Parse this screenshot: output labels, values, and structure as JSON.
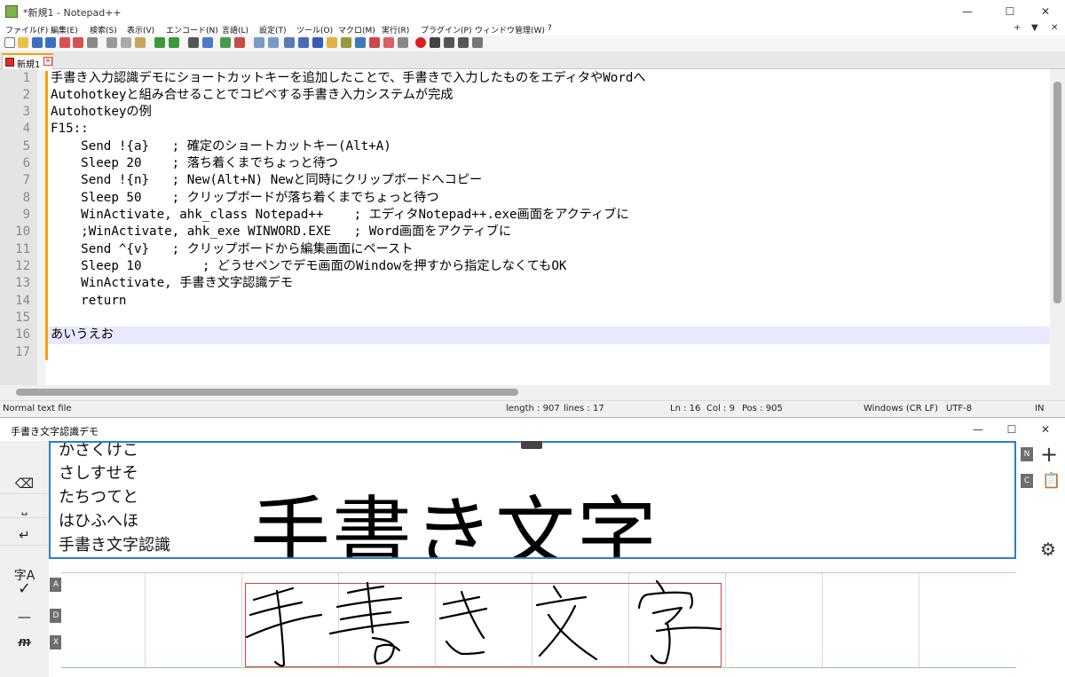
{
  "npp": {
    "title": "*新規1 - Notepad++",
    "menu": [
      "ファイル(F)",
      "編集(E)",
      "検索(S)",
      "表示(V)",
      "エンコード(N)",
      "言語(L)",
      "設定(T)",
      "ツール(O)",
      "マクロ(M)",
      "実行(R)",
      "プラグイン(P)",
      "ウィンドウ管理(W)",
      "?"
    ],
    "menu_right": [
      "+",
      "▼",
      "✕"
    ],
    "tab_label": "新規1",
    "lines": [
      "手書き入力認識デモにショートカットキーを追加したことで、手書きで入力したものをエディタやWordへ",
      "Autohotkeyと組み合せることでコピペする手書き入力システムが完成",
      "Autohotkeyの例",
      "F15::",
      "    Send !{a}   ; 確定のショートカットキー(Alt+A)",
      "    Sleep 20    ; 落ち着くまでちょっと待つ",
      "    Send !{n}   ; New(Alt+N) Newと同時にクリップボードへコピー",
      "    Sleep 50    ; クリップボードが落ち着くまでちょっと待つ",
      "    WinActivate, ahk_class Notepad++    ; エディタNotepad++.exe画面をアクティブに",
      "    ;WinActivate, ahk_exe WINWORD.EXE   ; Word画面をアクティブに",
      "    Send ^{v}   ; クリップボードから編集画面にペースト",
      "    Sleep 10        ; どうせペンでデモ画面のWindowを押すから指定しなくてもOK",
      "    WinActivate, 手書き文字認識デモ",
      "    return",
      "",
      "あいうえお",
      ""
    ],
    "line_numbers": [
      "1",
      "2",
      "3",
      "4",
      "5",
      "6",
      "7",
      "8",
      "9",
      "10",
      "11",
      "12",
      "13",
      "14",
      "15",
      "16",
      "17"
    ],
    "status": {
      "type": "Normal text file",
      "length": "length : 907",
      "lines": "lines : 17",
      "ln": "Ln : 16",
      "col": "Col : 9",
      "pos": "Pos : 905",
      "eol": "Windows (CR LF)",
      "encoding": "UTF-8",
      "mode": "IN"
    }
  },
  "hw": {
    "title": "手書き文字認識デモ",
    "candidates": [
      "かさくけこ",
      "さしすせそ",
      "たちつてと",
      "はひふへほ",
      "手書き文字認識"
    ],
    "result_text": "手書き文字",
    "left_buttons": {
      "backspace": "⌫",
      "space": "⎵",
      "enter": "↵",
      "confirm": "字A",
      "confirm_check": "✓",
      "dash": "—",
      "erase": "ᵯ"
    },
    "side_labels": {
      "a": "A",
      "d": "D",
      "x": "X",
      "n": "N",
      "c": "C"
    },
    "right_icons": {
      "add": "+",
      "clipboard": "📋",
      "settings": "⚙"
    },
    "ink_chars": [
      "手",
      "書",
      "き",
      "文",
      "字"
    ]
  }
}
